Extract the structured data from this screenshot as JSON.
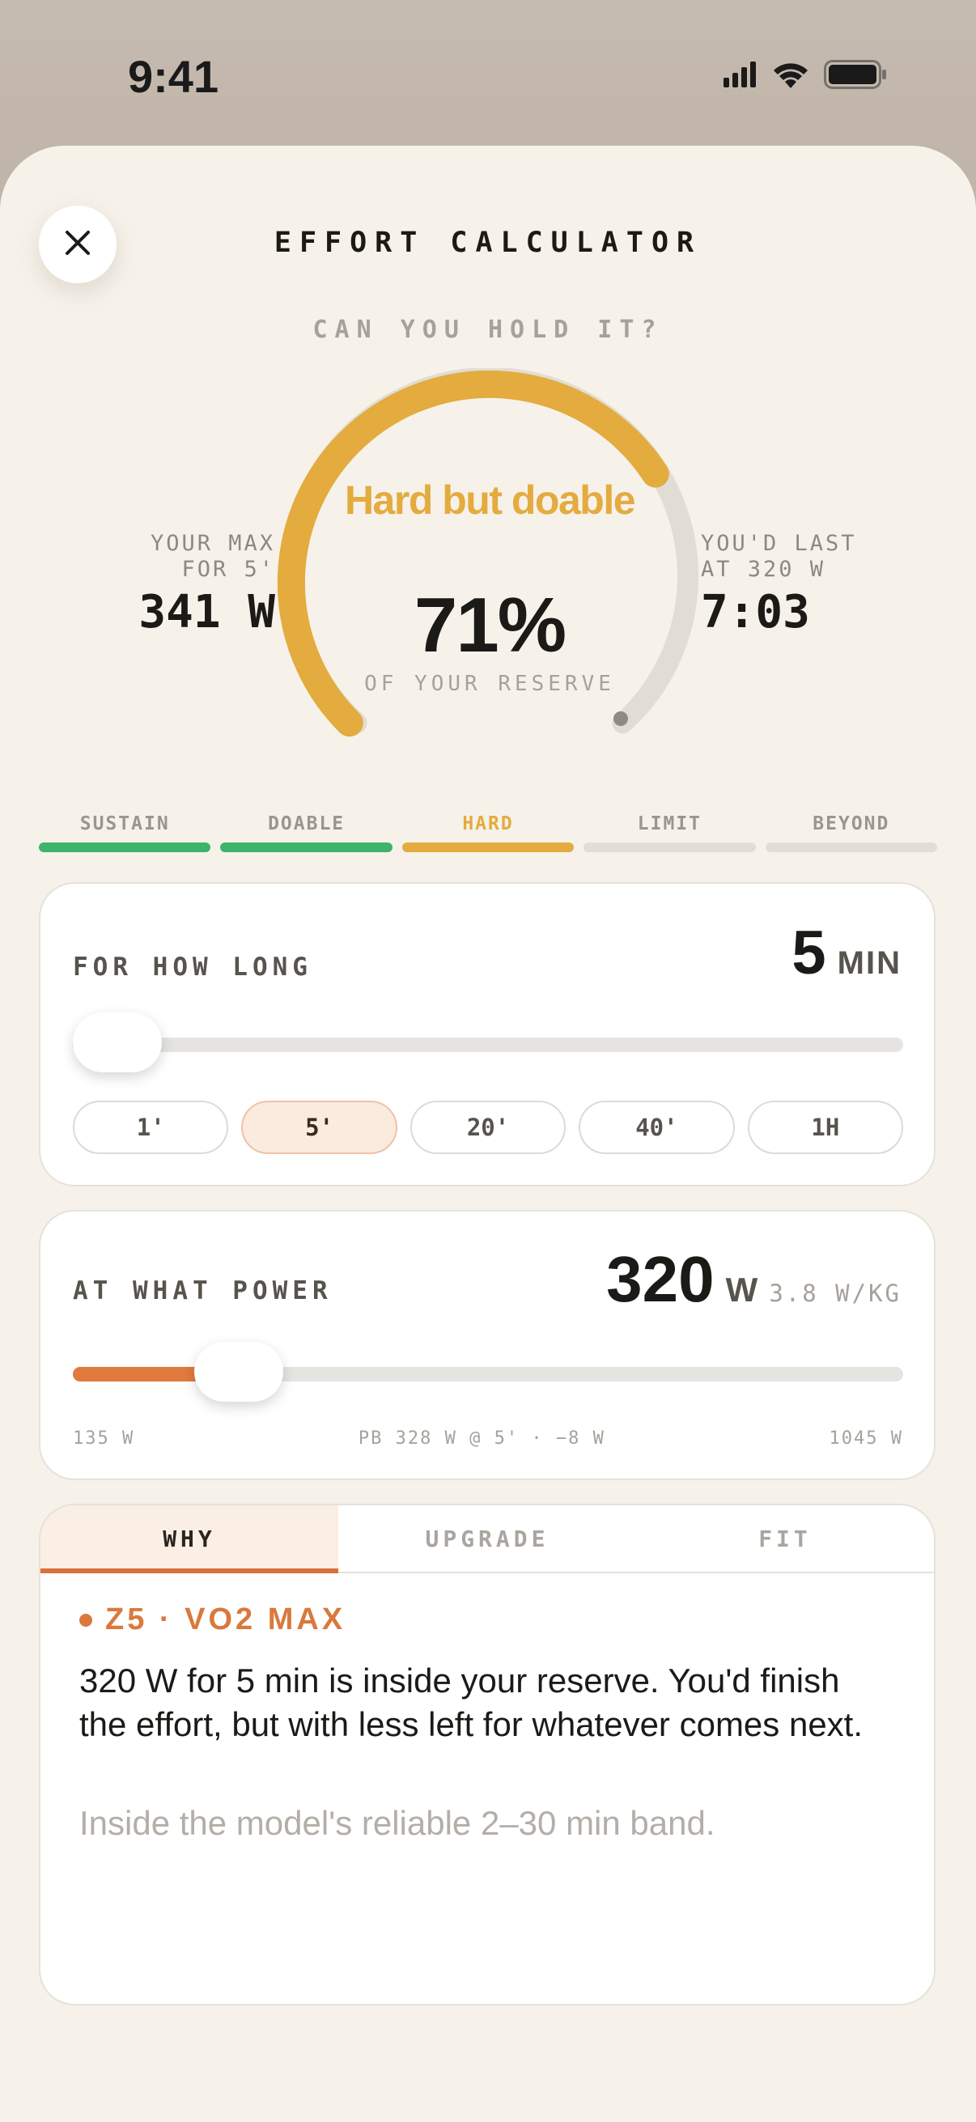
{
  "status_bar": {
    "time": "9:41",
    "icons": [
      "signal-icon",
      "wifi-icon",
      "battery-icon"
    ]
  },
  "header": {
    "title": "EFFORT CALCULATOR",
    "close_icon": "close-icon"
  },
  "gauge": {
    "question": "CAN YOU HOLD IT?",
    "verdict": "Hard but doable",
    "percent": "71%",
    "percent_value": 71,
    "caption": "OF YOUR RESERVE",
    "arc_color": "#e4ab3e",
    "left": {
      "label_line1": "YOUR MAX",
      "label_line2": "FOR 5'",
      "value": "341 W"
    },
    "right": {
      "label_line1": "YOU'D LAST",
      "label_line2": "AT 320 W",
      "value": "7:03"
    }
  },
  "zones": [
    {
      "label": "SUSTAIN",
      "color": "#3db36b",
      "active": false
    },
    {
      "label": "DOABLE",
      "color": "#3db36b",
      "active": false
    },
    {
      "label": "HARD",
      "color": "#e4ab3e",
      "active": true
    },
    {
      "label": "LIMIT",
      "color": "#e2ddd6",
      "active": false
    },
    {
      "label": "BEYOND",
      "color": "#e2ddd6",
      "active": false
    }
  ],
  "duration": {
    "label": "FOR HOW LONG",
    "value": "5",
    "unit": "MIN",
    "slider_fraction": 0.05,
    "presets": [
      {
        "label": "1'",
        "active": false
      },
      {
        "label": "5'",
        "active": true
      },
      {
        "label": "20'",
        "active": false
      },
      {
        "label": "40'",
        "active": false
      },
      {
        "label": "1H",
        "active": false
      }
    ]
  },
  "power": {
    "label": "AT WHAT POWER",
    "value": "320",
    "unit": "W",
    "per_kg": "3.8 W/KG",
    "slider_fraction": 0.2,
    "min_label": "135 W",
    "pb_label": "PB 328 W @ 5' · −8 W",
    "max_label": "1045 W"
  },
  "tabs": [
    {
      "label": "WHY",
      "active": true
    },
    {
      "label": "UPGRADE",
      "active": false
    },
    {
      "label": "FIT",
      "active": false
    }
  ],
  "why": {
    "zone_tag": "Z5 · VO2 MAX",
    "text": "320 W for 5 min is inside your reserve. You'd finish the effort, but with less left for whatever comes next.",
    "note": "Inside the model's reliable 2–30 min band."
  },
  "colors": {
    "accent": "#e07a3e",
    "gauge": "#e4ab3e",
    "background": "#f6f2ea"
  }
}
